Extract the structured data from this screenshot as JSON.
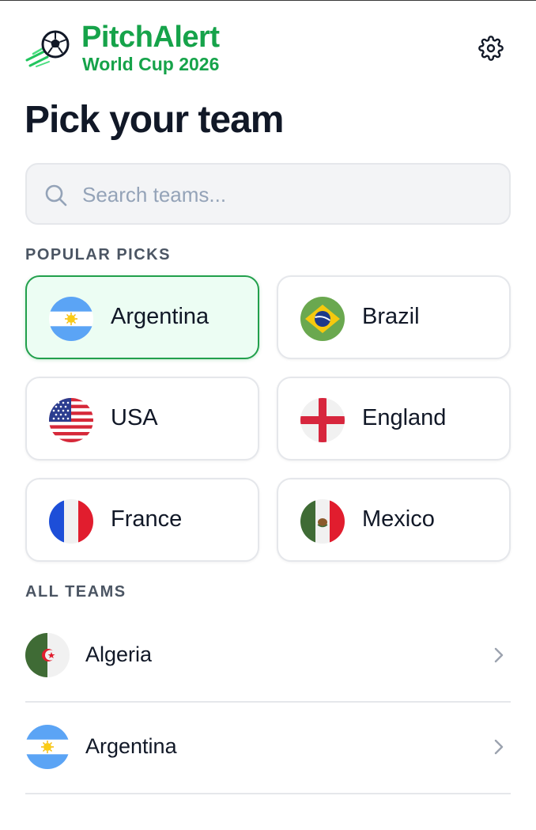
{
  "app": {
    "name": "PitchAlert",
    "subtitle": "World Cup 2026",
    "brand_color": "#16a34a"
  },
  "header": {
    "settings_icon": "gear-icon"
  },
  "page": {
    "title": "Pick your team"
  },
  "search": {
    "placeholder": "Search teams...",
    "value": "",
    "icon": "search-icon"
  },
  "popular": {
    "label": "POPULAR PICKS",
    "teams": [
      {
        "name": "Argentina",
        "flag": "argentina-flag-icon",
        "selected": true
      },
      {
        "name": "Brazil",
        "flag": "brazil-flag-icon",
        "selected": false
      },
      {
        "name": "USA",
        "flag": "usa-flag-icon",
        "selected": false
      },
      {
        "name": "England",
        "flag": "england-flag-icon",
        "selected": false
      },
      {
        "name": "France",
        "flag": "france-flag-icon",
        "selected": false
      },
      {
        "name": "Mexico",
        "flag": "mexico-flag-icon",
        "selected": false
      }
    ]
  },
  "all_teams": {
    "label": "ALL TEAMS",
    "items": [
      {
        "name": "Algeria",
        "flag": "algeria-flag-icon"
      },
      {
        "name": "Argentina",
        "flag": "argentina-flag-icon"
      }
    ]
  }
}
